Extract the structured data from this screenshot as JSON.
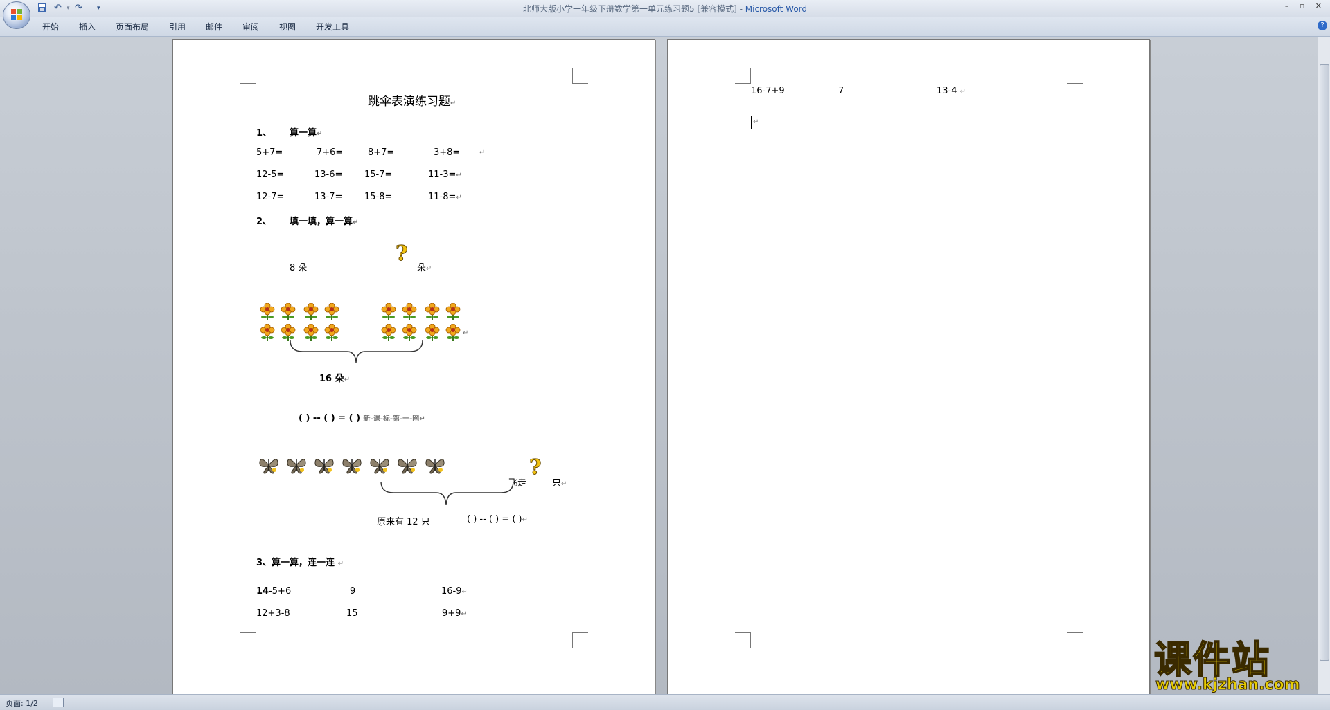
{
  "window": {
    "title": "北师大版小学一年级下册数学第一单元练习题5 [兼容模式] - ",
    "app_name": "Microsoft Word",
    "controls": "– ▫ ✕"
  },
  "ribbon": {
    "tabs": [
      "开始",
      "插入",
      "页面布局",
      "引用",
      "邮件",
      "审阅",
      "视图",
      "开发工具"
    ],
    "help": "?"
  },
  "page1": {
    "heading": "跳伞表演练习题",
    "section1": {
      "num": "1、",
      "title": "算一算",
      "rows": [
        [
          "5+7=",
          "7+6=",
          "8+7=",
          "3+8="
        ],
        [
          "12-5=",
          "13-6=",
          "15-7=",
          "11-3="
        ],
        [
          "12-7=",
          "13-7=",
          "15-8=",
          "11-8="
        ]
      ]
    },
    "section2": {
      "num": "2、",
      "title": "填一填，算一算",
      "left_count": "8 朵",
      "right_unit": "朵",
      "total": "16 朵",
      "equation1": "(     ) -- (     )  =    (     )",
      "equation1_tail": "新-课-标-第-一-网",
      "fly_away": "飞走",
      "unit_only": "只",
      "original": "原来有 12 只",
      "equation2": "(      ) -- (      ) = (      )"
    },
    "section3": {
      "title_num": "3",
      "title": "、算一算，连一连",
      "rows": [
        {
          "a_bold": "14",
          "a": "-5+6",
          "b": "9",
          "c": "16-9"
        },
        {
          "a_bold": "",
          "a": "12+3-8",
          "b": "15",
          "c": "9+9"
        }
      ]
    }
  },
  "page2": {
    "row": {
      "a": "16-7+9",
      "b": "7",
      "c": "13-4"
    }
  },
  "paragraph_mark": "↵",
  "statusbar": {
    "page": "页面: 1/2"
  },
  "watermark": {
    "title": "课件站",
    "url": "www.kjzhan.com"
  },
  "colors": {
    "accent": "#2a5aa8",
    "watermark": "#f2d600",
    "page_bg": "#ffffff",
    "workspace": "#c0c6ce"
  }
}
